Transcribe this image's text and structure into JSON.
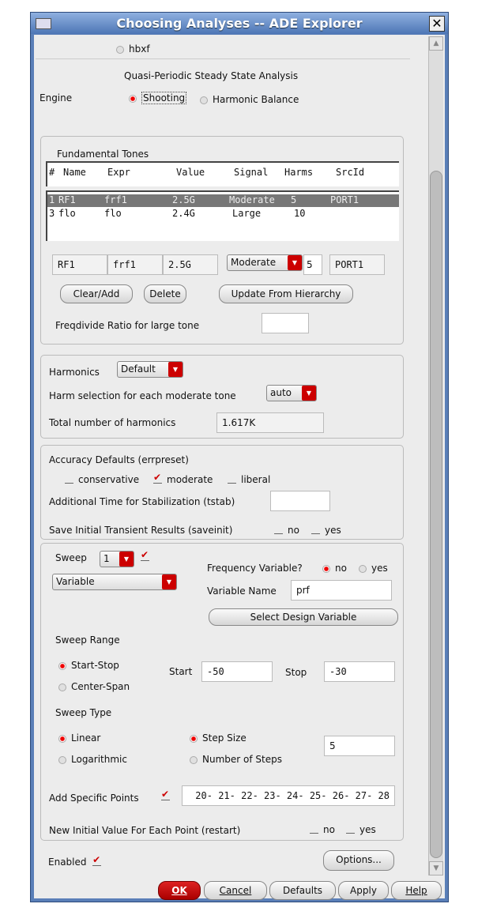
{
  "window": {
    "title": "Choosing Analyses -- ADE Explorer"
  },
  "top": {
    "hbxf": "hbxf",
    "analysis_title": "Quasi-Periodic Steady State Analysis",
    "engine_label": "Engine",
    "engine_options": [
      "Shooting",
      "Harmonic Balance"
    ],
    "engine_selected": "Shooting"
  },
  "tones": {
    "title": "Fundamental Tones",
    "headers": [
      "#",
      "Name",
      "Expr",
      "Value",
      "Signal",
      "Harms",
      "SrcId"
    ],
    "rows": [
      {
        "n": "1",
        "name": "RF1",
        "expr": "frf1",
        "value": "2.5G",
        "signal": "Moderate",
        "harms": "5",
        "srcid": "PORT1"
      },
      {
        "n": "3",
        "name": "flo",
        "expr": "flo",
        "value": "2.4G",
        "signal": "Large",
        "harms": "10",
        "srcid": ""
      }
    ],
    "edit": {
      "name": "RF1",
      "expr": "frf1",
      "value": "2.5G",
      "signal": "Moderate",
      "harms": "5",
      "srcid": "PORT1"
    },
    "clear_add": "Clear/Add",
    "delete": "Delete",
    "update": "Update From Hierarchy",
    "freqdivide_label": "Freqdivide Ratio for large tone",
    "freqdivide_value": ""
  },
  "harmonics": {
    "label": "Harmonics",
    "select": "Default",
    "harm_sel_label": "Harm selection for each moderate tone",
    "harm_sel": "auto",
    "total_label": "Total number of harmonics",
    "total": "1.617K"
  },
  "accuracy": {
    "label": "Accuracy Defaults (errpreset)",
    "options": [
      "conservative",
      "moderate",
      "liberal"
    ],
    "tstab_label": "Additional Time for Stabilization (tstab)",
    "tstab": "",
    "saveinit_label": "Save Initial Transient Results (saveinit)",
    "no": "no",
    "yes": "yes"
  },
  "sweep": {
    "label": "Sweep",
    "dim": "1",
    "type": "Variable",
    "freq_var_label": "Frequency Variable?",
    "no": "no",
    "yes": "yes",
    "var_name_label": "Variable Name",
    "var_name": "prf",
    "select_var": "Select Design Variable",
    "range_label": "Sweep Range",
    "start_stop": "Start-Stop",
    "center_span": "Center-Span",
    "start_label": "Start",
    "start": "-50",
    "stop_label": "Stop",
    "stop": "-30",
    "type_label": "Sweep Type",
    "linear": "Linear",
    "log": "Logarithmic",
    "step_size": "Step Size",
    "num_steps": "Number of Steps",
    "step": "5",
    "specific_label": "Add Specific Points",
    "specific": "28 -27 -26 -25 -24 -23 -22 -21 -20",
    "restart_label": "New Initial Value For Each Point (restart)"
  },
  "bottom": {
    "enabled": "Enabled",
    "options": "Options...",
    "ok": "OK",
    "cancel": "Cancel",
    "defaults": "Defaults",
    "apply": "Apply",
    "help": "Help"
  }
}
